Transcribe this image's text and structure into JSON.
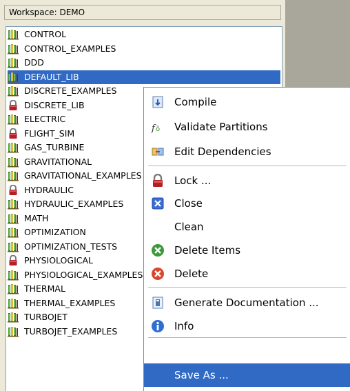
{
  "workspace": {
    "title": "Workspace: DEMO"
  },
  "libraries": [
    {
      "label": "CONTROL",
      "icon": "library-icon",
      "locked": false
    },
    {
      "label": "CONTROL_EXAMPLES",
      "icon": "library-icon",
      "locked": false
    },
    {
      "label": "DDD",
      "icon": "library-icon",
      "locked": false
    },
    {
      "label": "DEFAULT_LIB",
      "icon": "library-icon",
      "locked": false,
      "selected": true
    },
    {
      "label": "DISCRETE_EXAMPLES",
      "icon": "library-icon",
      "locked": false
    },
    {
      "label": "DISCRETE_LIB",
      "icon": "lock-icon",
      "locked": true
    },
    {
      "label": "ELECTRIC",
      "icon": "library-icon",
      "locked": false
    },
    {
      "label": "FLIGHT_SIM",
      "icon": "lock-icon",
      "locked": true
    },
    {
      "label": "GAS_TURBINE",
      "icon": "library-icon",
      "locked": false
    },
    {
      "label": "GRAVITATIONAL",
      "icon": "library-icon",
      "locked": false
    },
    {
      "label": "GRAVITATIONAL_EXAMPLES",
      "icon": "library-icon",
      "locked": false
    },
    {
      "label": "HYDRAULIC",
      "icon": "lock-icon",
      "locked": true
    },
    {
      "label": "HYDRAULIC_EXAMPLES",
      "icon": "library-icon",
      "locked": false
    },
    {
      "label": "MATH",
      "icon": "library-icon",
      "locked": false
    },
    {
      "label": "OPTIMIZATION",
      "icon": "library-icon",
      "locked": false
    },
    {
      "label": "OPTIMIZATION_TESTS",
      "icon": "library-icon",
      "locked": false
    },
    {
      "label": "PHYSIOLOGICAL",
      "icon": "lock-icon",
      "locked": true
    },
    {
      "label": "PHYSIOLOGICAL_EXAMPLES",
      "icon": "library-icon",
      "locked": false
    },
    {
      "label": "THERMAL",
      "icon": "library-icon",
      "locked": false
    },
    {
      "label": "THERMAL_EXAMPLES",
      "icon": "library-icon",
      "locked": false
    },
    {
      "label": "TURBOJET",
      "icon": "library-icon",
      "locked": false
    },
    {
      "label": "TURBOJET_EXAMPLES",
      "icon": "library-icon",
      "locked": false
    }
  ],
  "context_menu": {
    "items": [
      {
        "label": "Compile",
        "icon": "compile-icon"
      },
      {
        "label": "Validate Partitions",
        "icon": "validate-icon"
      },
      {
        "label": "Edit Dependencies",
        "icon": "dependencies-icon"
      },
      {
        "label": "Lock ...",
        "icon": "lock-icon"
      },
      {
        "label": "Close",
        "icon": "close-icon"
      },
      {
        "label": "Clean",
        "icon": ""
      },
      {
        "label": "Delete Items",
        "icon": "delete-items-icon"
      },
      {
        "label": "Delete",
        "icon": "delete-icon"
      },
      {
        "label": "Generate Documentation ...",
        "icon": "documentation-icon"
      },
      {
        "label": "Info",
        "icon": "info-icon"
      },
      {
        "label": "Save As ...",
        "icon": "",
        "highlighted": true
      }
    ]
  },
  "colors": {
    "selection": "#316ac5",
    "panel": "#ece9d8",
    "desktop": "#a9a79c"
  }
}
